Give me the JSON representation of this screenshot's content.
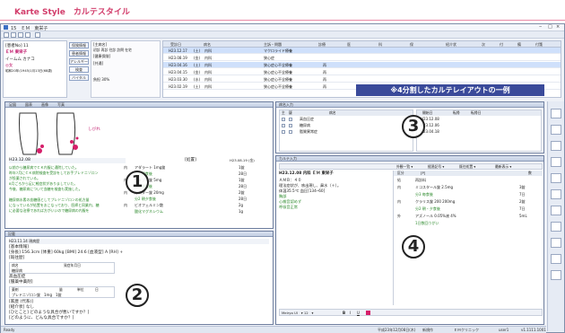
{
  "banner": {
    "title": "Karte Style　カルテスタイル"
  },
  "window": {
    "title": "15　ＥＭ　東栄子"
  },
  "patient": {
    "id_label": "[患者No] 11",
    "name": "ＥＭ 東栄子",
    "kana": "イームム カナコ",
    "sex": "◎女",
    "birth": "昭和20年(1945)1月13日(68歳)"
  },
  "patient_buttons": [
    "保険情報",
    "患者情報",
    "アレルギー",
    "検査",
    "バイタル"
  ],
  "options": {
    "line1": "[主病名]",
    "line2": "初診 再診 往診 訪問 在宅",
    "line3": "[健康保険]",
    "line4": "[共通]",
    "line5": "負担 30%"
  },
  "visit_grid": {
    "headers": [
      "受診日",
      "病名",
      "主訴・問題",
      "診療",
      "医",
      "科",
      "保",
      "紹介状",
      "次",
      "付",
      "備",
      "付箋"
    ],
    "rows": [
      {
        "date": "H23.12.17",
        "a": "(土)",
        "b": "内科",
        "c": "マクロライド療養",
        "sel": true
      },
      {
        "date": "H23.08.19",
        "a": "(金)",
        "b": "内科",
        "c": "狭心症",
        "sel": false
      },
      {
        "date": "H23.04.16",
        "a": "(土)",
        "b": "内科",
        "c": "狭心症心不全療養",
        "d": "再",
        "sel": true
      },
      {
        "date": "H23.04.15",
        "a": "(金)",
        "b": "内科",
        "c": "狭心症心不全療養",
        "d": "再",
        "sel": false
      },
      {
        "date": "H23.03.30",
        "a": "(水)",
        "b": "内科",
        "c": "狭心症心不全療養",
        "d": "再",
        "sel": false
      },
      {
        "date": "H23.02.19",
        "a": "(土)",
        "b": "内科",
        "c": "狭心症心不全療養",
        "d": "再",
        "sel": false
      }
    ]
  },
  "callout": "※4分割したカルテレイアウトの一例",
  "panel1": {
    "tabs": [
      "足図",
      "図表",
      "画像",
      "写真"
    ],
    "shibire": "しびれ",
    "date": "H23.12.08",
    "date2": "H23.08.19 (金)",
    "header_right": "[処置]",
    "notes": [
      "以前から糖尿病でＣＫ内服に通院していた。",
      "昨年7月にＣＫ病院検査を受診をしてお手プレドニゾロン",
      "が投薬されている。",
      "8月ごろから足に軽症状がありましていた。",
      "今後、糖尿病について血糖を検査も実施した。",
      "",
      "糖尿病水素の血糖値としてプレドニゾロンの処方量",
      "になっているが処置をおこなっており、医師と同業内、糖",
      "に必要な治療であれば方がいいので糖尿病の内服を"
    ],
    "meds": [
      {
        "k": "内",
        "n": "アダラート 1mg錠",
        "q": "1錠"
      },
      {
        "k": "",
        "n": "分1 朝食後",
        "q": "28日"
      },
      {
        "k": "内",
        "n": "ワイブレ錠 5mg",
        "q": "1錠"
      },
      {
        "k": "",
        "n": "分1 朝食後",
        "q": "28日"
      },
      {
        "k": "内",
        "n": "ガスター錠 20mg",
        "q": "2錠"
      },
      {
        "k": "",
        "n": "分2 朝夕食後",
        "q": "28日"
      },
      {
        "k": "内",
        "n": "ビオフェルミン散",
        "q": "2g"
      },
      {
        "k": "",
        "n": "酸化マグネシウム",
        "q": "1g"
      }
    ]
  },
  "panel2": {
    "tab": "記載",
    "date": "H23.11.14 現病歴",
    "l1": "[基本情報]",
    "l2": "[身長] 156.3cm [体重] 60kg [BMI] 24.6 [血液型] A [RH] +",
    "l3": "[既往歴]",
    "l4": "糖尿病",
    "l5": "高血圧症",
    "tbl_h": [
      "病名",
      "発症年月日"
    ],
    "l6": "[服薬中薬剤]",
    "tbl2_h": [
      "薬剤",
      "量",
      "単位",
      "日"
    ],
    "drug": "プレドニゾロン錠　1mg　1錠",
    "l7": "[家歴 (代系)]",
    "l8": "[紹介状] なし",
    "l9": "[ひとこと] どのような具合が悪いですか？]",
    "l10": "[どのように、どんな具合ですか？]"
  },
  "panel3": {
    "tab": "病名入力",
    "headers": [
      "主",
      "疑",
      "病名"
    ],
    "rows": [
      "高血圧症",
      "糖尿病",
      "脂質異常症"
    ],
    "r_headers": [
      "開始日",
      "転帰",
      "転帰日"
    ],
    "r_rows": [
      "H23.12.08",
      "H23.12.06",
      "H23.04.18"
    ]
  },
  "panel4": {
    "tab": "カルテ入力",
    "date": "H23.12.08 内科 ＥＭ 東栄子",
    "so": [
      "ＡＭＢ：４０",
      "理法症状が、咳出現し、鼻水（＋）。",
      "体温35.5℃ 血圧[134─60]",
      "胸部",
      "心雑音認めず",
      "呼吸音正常"
    ],
    "rx_h": [
      "区分",
      "[P]",
      "",
      "数"
    ],
    "rx": [
      {
        "k": "処",
        "n": "再診料",
        "q": ""
      },
      {
        "k": "内",
        "n": "ミコスタール錠 2.5mg",
        "q": "3錠"
      },
      {
        "k": "",
        "n": "分3 毎食後",
        "q": "7日"
      },
      {
        "k": "内",
        "n": "クラリス錠 200 200mg",
        "q": "2錠"
      },
      {
        "k": "",
        "n": "分2 朝・夕食後",
        "q": "7日"
      },
      {
        "k": "外",
        "n": "アズノール 0.05%液 4%",
        "q": "5mL"
      },
      {
        "k": "",
        "n": "1日数回うがい",
        "q": ""
      }
    ],
    "toolbar": "Meiryo UI　▾ 12　▾",
    "selects": [
      "外観一覧 ▾",
      "経過記号 ▾",
      "既往処置 ▾",
      "最新表示 ▾"
    ]
  },
  "status": {
    "left": "Ready",
    "date": "平成23年12月08日(木)",
    "mode": "新規作",
    "clinic": "ＥＭクリニック",
    "user": "user1",
    "ver": "v1.1111.1001"
  }
}
